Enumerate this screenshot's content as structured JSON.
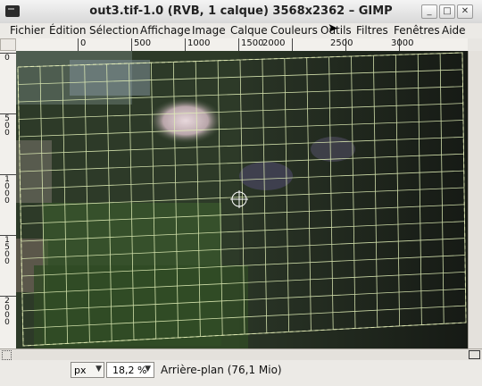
{
  "window": {
    "title": "out3.tif-1.0 (RVB, 1 calque) 3568x2362 – GIMP",
    "controls": {
      "minimize": "_",
      "maximize": "□",
      "close": "✕"
    }
  },
  "menu": [
    "Fichier",
    "Édition",
    "Sélection",
    "Affichage",
    "Image",
    "Calque",
    "Couleurs",
    "Outils",
    "Filtres",
    "Fenêtres",
    "Aide"
  ],
  "ruler": {
    "horizontal": [
      "0",
      "500",
      "1000",
      "1500",
      "2000",
      "2500",
      "3000"
    ],
    "vertical": [
      "0",
      "500",
      "1000",
      "1500",
      "2000"
    ]
  },
  "status": {
    "unit": "px",
    "zoom": "18,2 %",
    "text": "Arrière-plan (76,1 Mio)"
  },
  "colors": {
    "grid": "#e2f0b8",
    "canvas_dark": "#263020"
  }
}
